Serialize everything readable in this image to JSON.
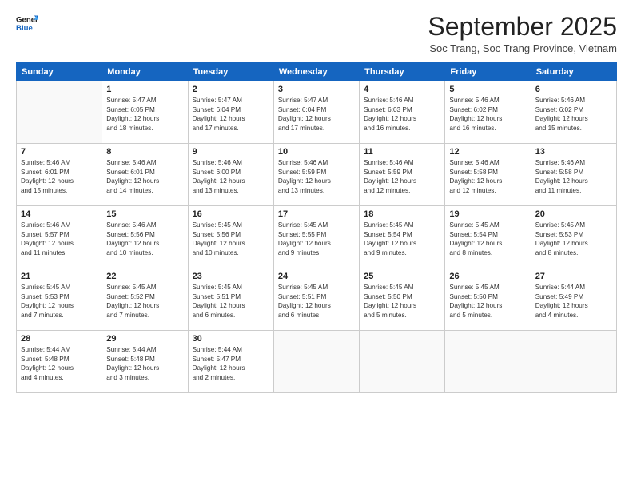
{
  "logo": {
    "line1": "General",
    "line2": "Blue"
  },
  "title": "September 2025",
  "subtitle": "Soc Trang, Soc Trang Province, Vietnam",
  "weekdays": [
    "Sunday",
    "Monday",
    "Tuesday",
    "Wednesday",
    "Thursday",
    "Friday",
    "Saturday"
  ],
  "weeks": [
    [
      {
        "day": "",
        "info": ""
      },
      {
        "day": "1",
        "info": "Sunrise: 5:47 AM\nSunset: 6:05 PM\nDaylight: 12 hours\nand 18 minutes."
      },
      {
        "day": "2",
        "info": "Sunrise: 5:47 AM\nSunset: 6:04 PM\nDaylight: 12 hours\nand 17 minutes."
      },
      {
        "day": "3",
        "info": "Sunrise: 5:47 AM\nSunset: 6:04 PM\nDaylight: 12 hours\nand 17 minutes."
      },
      {
        "day": "4",
        "info": "Sunrise: 5:46 AM\nSunset: 6:03 PM\nDaylight: 12 hours\nand 16 minutes."
      },
      {
        "day": "5",
        "info": "Sunrise: 5:46 AM\nSunset: 6:02 PM\nDaylight: 12 hours\nand 16 minutes."
      },
      {
        "day": "6",
        "info": "Sunrise: 5:46 AM\nSunset: 6:02 PM\nDaylight: 12 hours\nand 15 minutes."
      }
    ],
    [
      {
        "day": "7",
        "info": "Sunrise: 5:46 AM\nSunset: 6:01 PM\nDaylight: 12 hours\nand 15 minutes."
      },
      {
        "day": "8",
        "info": "Sunrise: 5:46 AM\nSunset: 6:01 PM\nDaylight: 12 hours\nand 14 minutes."
      },
      {
        "day": "9",
        "info": "Sunrise: 5:46 AM\nSunset: 6:00 PM\nDaylight: 12 hours\nand 13 minutes."
      },
      {
        "day": "10",
        "info": "Sunrise: 5:46 AM\nSunset: 5:59 PM\nDaylight: 12 hours\nand 13 minutes."
      },
      {
        "day": "11",
        "info": "Sunrise: 5:46 AM\nSunset: 5:59 PM\nDaylight: 12 hours\nand 12 minutes."
      },
      {
        "day": "12",
        "info": "Sunrise: 5:46 AM\nSunset: 5:58 PM\nDaylight: 12 hours\nand 12 minutes."
      },
      {
        "day": "13",
        "info": "Sunrise: 5:46 AM\nSunset: 5:58 PM\nDaylight: 12 hours\nand 11 minutes."
      }
    ],
    [
      {
        "day": "14",
        "info": "Sunrise: 5:46 AM\nSunset: 5:57 PM\nDaylight: 12 hours\nand 11 minutes."
      },
      {
        "day": "15",
        "info": "Sunrise: 5:46 AM\nSunset: 5:56 PM\nDaylight: 12 hours\nand 10 minutes."
      },
      {
        "day": "16",
        "info": "Sunrise: 5:45 AM\nSunset: 5:56 PM\nDaylight: 12 hours\nand 10 minutes."
      },
      {
        "day": "17",
        "info": "Sunrise: 5:45 AM\nSunset: 5:55 PM\nDaylight: 12 hours\nand 9 minutes."
      },
      {
        "day": "18",
        "info": "Sunrise: 5:45 AM\nSunset: 5:54 PM\nDaylight: 12 hours\nand 9 minutes."
      },
      {
        "day": "19",
        "info": "Sunrise: 5:45 AM\nSunset: 5:54 PM\nDaylight: 12 hours\nand 8 minutes."
      },
      {
        "day": "20",
        "info": "Sunrise: 5:45 AM\nSunset: 5:53 PM\nDaylight: 12 hours\nand 8 minutes."
      }
    ],
    [
      {
        "day": "21",
        "info": "Sunrise: 5:45 AM\nSunset: 5:53 PM\nDaylight: 12 hours\nand 7 minutes."
      },
      {
        "day": "22",
        "info": "Sunrise: 5:45 AM\nSunset: 5:52 PM\nDaylight: 12 hours\nand 7 minutes."
      },
      {
        "day": "23",
        "info": "Sunrise: 5:45 AM\nSunset: 5:51 PM\nDaylight: 12 hours\nand 6 minutes."
      },
      {
        "day": "24",
        "info": "Sunrise: 5:45 AM\nSunset: 5:51 PM\nDaylight: 12 hours\nand 6 minutes."
      },
      {
        "day": "25",
        "info": "Sunrise: 5:45 AM\nSunset: 5:50 PM\nDaylight: 12 hours\nand 5 minutes."
      },
      {
        "day": "26",
        "info": "Sunrise: 5:45 AM\nSunset: 5:50 PM\nDaylight: 12 hours\nand 5 minutes."
      },
      {
        "day": "27",
        "info": "Sunrise: 5:44 AM\nSunset: 5:49 PM\nDaylight: 12 hours\nand 4 minutes."
      }
    ],
    [
      {
        "day": "28",
        "info": "Sunrise: 5:44 AM\nSunset: 5:48 PM\nDaylight: 12 hours\nand 4 minutes."
      },
      {
        "day": "29",
        "info": "Sunrise: 5:44 AM\nSunset: 5:48 PM\nDaylight: 12 hours\nand 3 minutes."
      },
      {
        "day": "30",
        "info": "Sunrise: 5:44 AM\nSunset: 5:47 PM\nDaylight: 12 hours\nand 2 minutes."
      },
      {
        "day": "",
        "info": ""
      },
      {
        "day": "",
        "info": ""
      },
      {
        "day": "",
        "info": ""
      },
      {
        "day": "",
        "info": ""
      }
    ]
  ]
}
